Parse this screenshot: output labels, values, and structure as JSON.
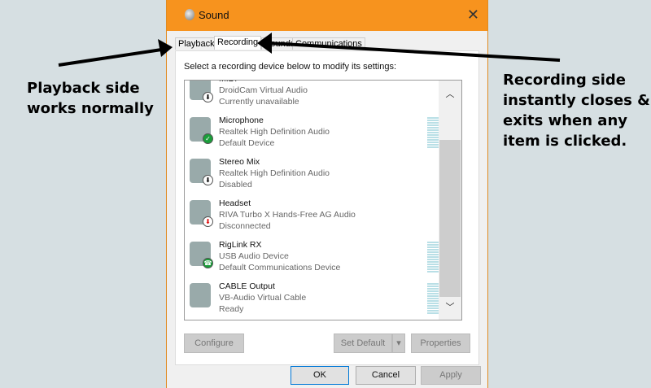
{
  "window": {
    "title": "Sound",
    "close": "✕"
  },
  "tabs": [
    "Playback",
    "Recording",
    "Sounds",
    "Communications"
  ],
  "active_tab": "Recording",
  "instruction": "Select a recording device below to modify its settings:",
  "devices": [
    {
      "name": "MIDI",
      "desc": "DroidCam Virtual Audio",
      "status": "Currently unavailable",
      "badge": "down-arrow"
    },
    {
      "name": "Microphone",
      "desc": "Realtek High Definition Audio",
      "status": "Default Device",
      "badge": "check"
    },
    {
      "name": "Stereo Mix",
      "desc": "Realtek High Definition Audio",
      "status": "Disabled",
      "badge": "down-arrow"
    },
    {
      "name": "Headset",
      "desc": "RIVA Turbo X Hands-Free AG Audio",
      "status": "Disconnected",
      "badge": "red-down-arrow"
    },
    {
      "name": "RigLink RX",
      "desc": "USB Audio Device",
      "status": "Default Communications Device",
      "badge": "phone"
    },
    {
      "name": "CABLE Output",
      "desc": "VB-Audio Virtual Cable",
      "status": "Ready",
      "badge": "none"
    }
  ],
  "buttons": {
    "configure": "Configure",
    "set_default": "Set Default",
    "properties": "Properties",
    "ok": "OK",
    "cancel": "Cancel",
    "apply": "Apply"
  },
  "annotations": {
    "left": [
      "Playback side",
      "works normally"
    ],
    "right": [
      "Recording side",
      "instantly closes &",
      "exits when any",
      "item is clicked."
    ]
  },
  "colors": {
    "titlebar": "#f7931e",
    "accent": "#0078d7"
  }
}
